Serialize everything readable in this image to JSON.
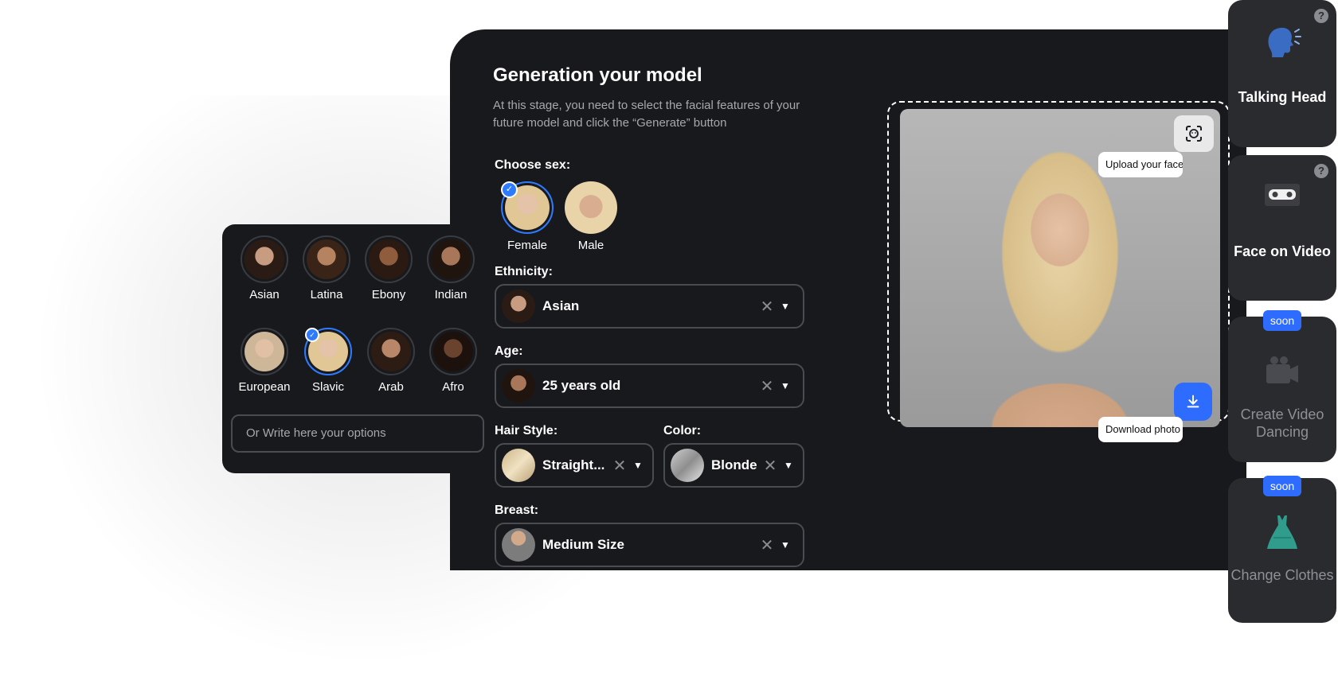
{
  "main": {
    "title": "Generation your model",
    "description": "At this stage, you need to select the facial features of your future model and click the “Generate” button",
    "sex_label": "Choose sex:",
    "sex_options": [
      {
        "label": "Female",
        "selected": true
      },
      {
        "label": "Male",
        "selected": false
      }
    ],
    "ethnicity_label": "Ethnicity:",
    "ethnicity_value": "Asian",
    "age_label": "Age:",
    "age_value": "25 years old",
    "hair_label": "Hair Style:",
    "hair_value": "Straight...",
    "color_label": "Color:",
    "color_value": "Blonde",
    "breast_label": "Breast:",
    "breast_value": "Medium Size",
    "upload_tooltip": "Upload your face",
    "download_tooltip": "Download photo"
  },
  "ethnicity_panel": {
    "items": [
      {
        "label": "Asian",
        "selected": false
      },
      {
        "label": "Latina",
        "selected": false
      },
      {
        "label": "Ebony",
        "selected": false
      },
      {
        "label": "Indian",
        "selected": false
      },
      {
        "label": "European",
        "selected": false
      },
      {
        "label": "Slavic",
        "selected": true
      },
      {
        "label": "Arab",
        "selected": false
      },
      {
        "label": "Afro",
        "selected": false
      }
    ],
    "input_placeholder": "Or Write here your options"
  },
  "cards": [
    {
      "title": "Talking Head",
      "icon": "speaking-head-icon",
      "help": "?",
      "badge": ""
    },
    {
      "title": "Face on Video",
      "icon": "videocassette-icon",
      "help": "?",
      "badge": ""
    },
    {
      "title": "Create Video Dancing",
      "icon": "video-camera-icon",
      "help": "",
      "badge": "soon"
    },
    {
      "title": "Change Clothes",
      "icon": "dress-icon",
      "help": "",
      "badge": "soon"
    }
  ],
  "colors": {
    "accent": "#2e6cff",
    "panel": "#18191c",
    "card": "#2a2b2f",
    "teal": "#2f9c8c"
  }
}
